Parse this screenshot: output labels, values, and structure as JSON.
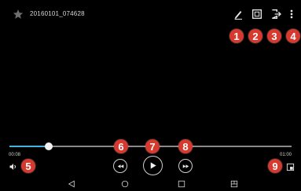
{
  "video": {
    "title": "20160101_074628",
    "current_time": "00:08",
    "duration": "01:00",
    "progress_fraction": 0.14
  },
  "callouts": [
    "1",
    "2",
    "3",
    "4",
    "5",
    "6",
    "7",
    "8",
    "9"
  ],
  "colors": {
    "background": "#000000",
    "callout": "#d8392f",
    "progress": "#3fb5e0",
    "track": "#8a8a8a",
    "icon": "#e6e6e6"
  },
  "icons": {
    "favorite": "star-icon",
    "edit": "pencil-icon",
    "capture": "capture-icon",
    "share": "share-icon",
    "more": "more-vert-icon",
    "volume": "volume-icon",
    "rewind": "rewind-icon",
    "play": "play-icon",
    "forward": "fast-forward-icon",
    "popup": "popup-play-icon",
    "nav_back": "back-triangle-icon",
    "nav_home": "home-circle-icon",
    "nav_recent": "recent-square-icon",
    "nav_dual": "dual-window-icon"
  }
}
